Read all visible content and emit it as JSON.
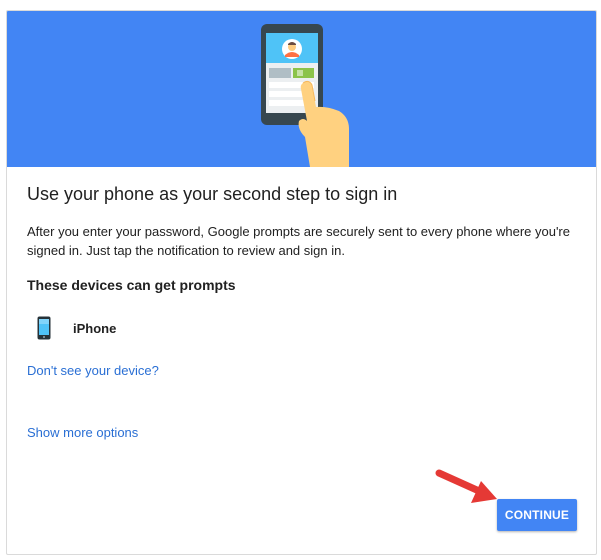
{
  "colors": {
    "hero_background": "#4285f4",
    "button_background": "#4285f4",
    "link": "#2a6fd4",
    "annotation_arrow": "#e53935"
  },
  "hero": {
    "illustration": "phone-tap-illustration"
  },
  "main": {
    "title": "Use your phone as your second step to sign in",
    "description": "After you enter your password, Google prompts are securely sent to every phone where you're signed in. Just tap the notification to review and sign in.",
    "devices_heading": "These devices can get prompts",
    "devices": [
      {
        "name": "iPhone",
        "icon": "smartphone-icon"
      }
    ],
    "dont_see_link": "Don't see your device?",
    "show_more_link": "Show more options"
  },
  "actions": {
    "continue_label": "CONTINUE"
  },
  "annotation": {
    "icon": "red-arrow-icon"
  }
}
